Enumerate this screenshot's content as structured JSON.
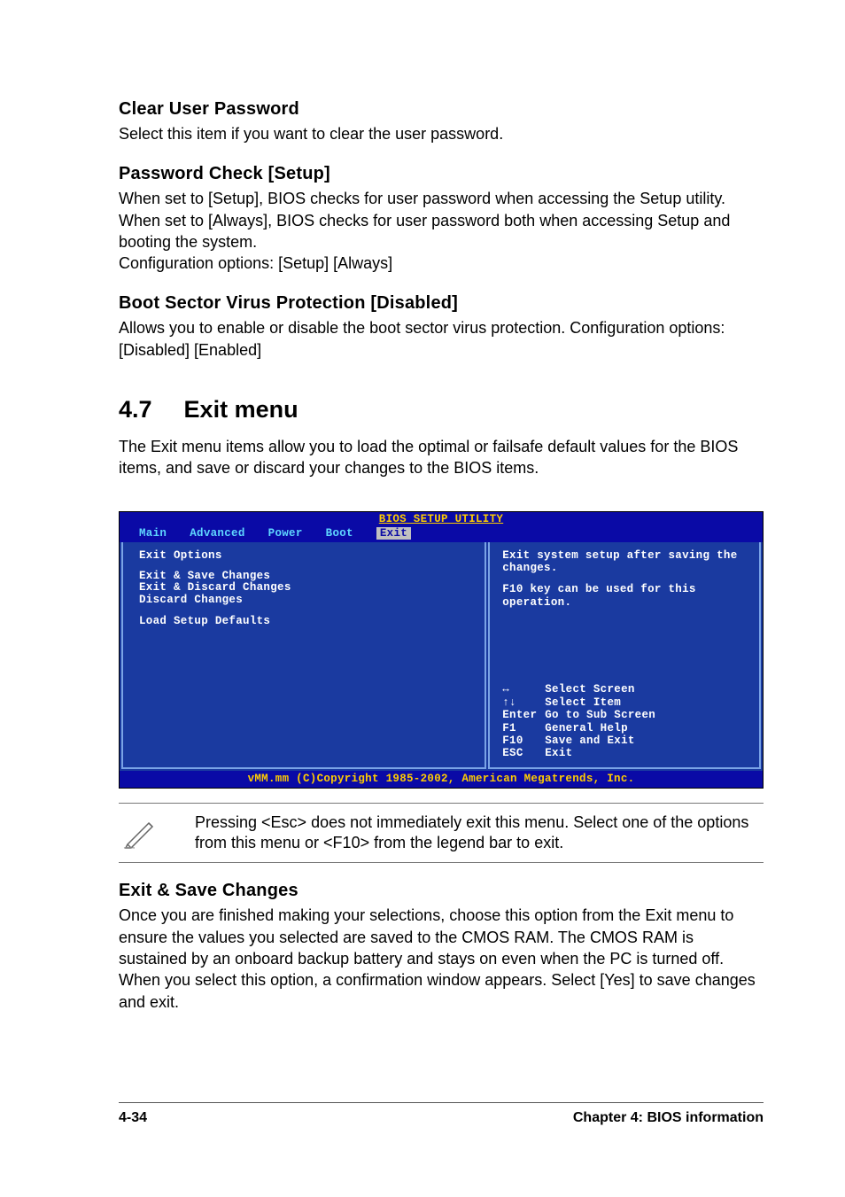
{
  "sections": {
    "clear_user_password": {
      "heading": "Clear User Password",
      "body": "Select this item if you want to clear the user password."
    },
    "password_check": {
      "heading": "Password Check [Setup]",
      "body": "When set to [Setup], BIOS checks for user password when accessing the Setup utility. When set to [Always], BIOS checks for user password both when accessing Setup and booting the system.\nConfiguration options: [Setup] [Always]"
    },
    "boot_sector": {
      "heading": "Boot Sector Virus Protection [Disabled]",
      "body": "Allows you to enable or disable the boot sector virus protection. Configuration options: [Disabled] [Enabled]"
    },
    "exit_menu": {
      "number": "4.7",
      "title": "Exit menu",
      "intro": "The Exit menu items allow you to load the optimal or failsafe default values for the BIOS items, and save or discard your changes to the BIOS items."
    },
    "exit_save": {
      "heading": "Exit & Save Changes",
      "body": "Once you are finished making your selections, choose this option from the Exit menu to ensure the values you selected are saved to the CMOS RAM. The CMOS RAM is sustained by an onboard backup battery and stays on even when the PC is turned off. When you select this option, a confirmation window appears. Select [Yes] to save changes and exit."
    }
  },
  "bios": {
    "title": "BIOS SETUP UTILITY",
    "tabs": [
      "Main",
      "Advanced",
      "Power",
      "Boot",
      "Exit"
    ],
    "active_tab": "Exit",
    "left": {
      "header": "Exit Options",
      "items": [
        "Exit & Save Changes",
        "Exit & Discard Changes",
        "Discard Changes",
        "",
        "Load Setup Defaults"
      ]
    },
    "right": {
      "help1": "Exit system setup after saving the changes.",
      "help2": "F10 key can be used for this operation.",
      "legend": [
        {
          "key": "↔",
          "val": "Select Screen"
        },
        {
          "key": "↑↓",
          "val": "Select Item"
        },
        {
          "key": "Enter",
          "val": "Go to Sub Screen"
        },
        {
          "key": "F1",
          "val": "General Help"
        },
        {
          "key": "F10",
          "val": "Save and Exit"
        },
        {
          "key": "ESC",
          "val": "Exit"
        }
      ]
    },
    "footer": "vMM.mm (C)Copyright 1985-2002, American Megatrends, Inc."
  },
  "note": "Pressing <Esc> does not immediately exit this menu. Select one of the options from this menu or <F10> from the legend bar to exit.",
  "page_footer": {
    "left": "4-34",
    "right": "Chapter 4: BIOS information"
  }
}
